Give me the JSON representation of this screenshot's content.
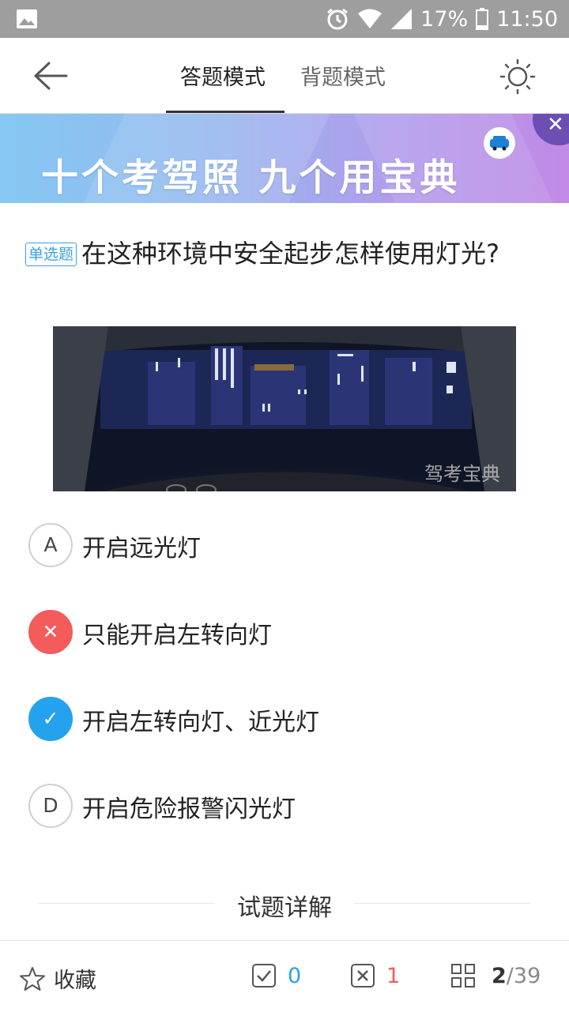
{
  "status_bar": {
    "battery": "17%",
    "time": "11:50",
    "icons": [
      "image-icon",
      "alarm-icon",
      "wifi-icon",
      "signal-icon",
      "battery-icon"
    ]
  },
  "header": {
    "tabs": [
      {
        "label": "答题模式",
        "active": true
      },
      {
        "label": "背题模式",
        "active": false
      }
    ],
    "back_icon": "arrow-left-icon",
    "theme_icon": "sun-icon"
  },
  "banner": {
    "text": "十个考驾照 九个用宝典",
    "close_icon": "close-icon",
    "logo_icon": "car-logo-icon"
  },
  "question": {
    "type_badge": "单选题",
    "text": "在这种环境中安全起步怎样使用灯光?",
    "image_watermark": "驾考宝典"
  },
  "options": [
    {
      "marker": "A",
      "text": "开启远光灯",
      "state": "normal"
    },
    {
      "marker": "✕",
      "text": "只能开启左转向灯",
      "state": "wrong"
    },
    {
      "marker": "✓",
      "text": "开启左转向灯、近光灯",
      "state": "right"
    },
    {
      "marker": "D",
      "text": "开启危险报警闪光灯",
      "state": "normal"
    }
  ],
  "explain": {
    "title": "试题详解"
  },
  "bottom_bar": {
    "favorite_label": "收藏",
    "right_count": "0",
    "wrong_count": "1",
    "current": "2",
    "total": "/39"
  },
  "colors": {
    "right": "#25a2ee",
    "wrong": "#f45b5b",
    "status_bar": "#9e9e9e"
  }
}
